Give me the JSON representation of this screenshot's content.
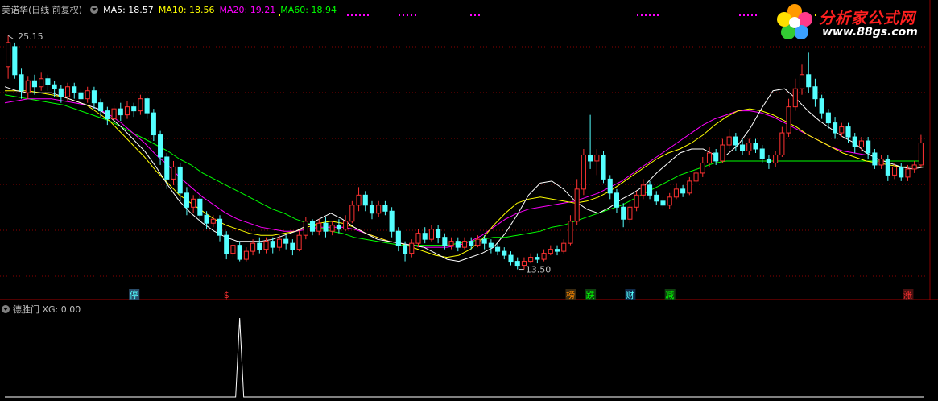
{
  "header": {
    "stock": "美诺华(日线 前复权)",
    "ma5": "MA5: 18.57",
    "ma10": "MA10: 18.56",
    "ma20": "MA20: 19.21",
    "ma60": "MA60: 18.94"
  },
  "indicator": {
    "name": "德胜门",
    "value": "XG: 0.00"
  },
  "logo": {
    "title": "分析家公式网",
    "url": "www.88gs.com"
  },
  "colors": {
    "up": "#ff3232",
    "down": "#54ffff",
    "ma5": "#ffffff",
    "ma10": "#ffff00",
    "ma20": "#ff00ff",
    "ma60": "#00ff00",
    "grid": "#8b0000"
  },
  "chart_data": {
    "type": "candlestick",
    "price_max_label": "25.15",
    "price_min_label": "13.50",
    "ylim": [
      12.8,
      26.2
    ],
    "candles": [
      [
        23.6,
        24.8,
        23.0,
        25.15
      ],
      [
        24.6,
        23.2,
        23.0,
        24.8
      ],
      [
        23.2,
        22.4,
        22.0,
        23.5
      ],
      [
        22.3,
        22.9,
        22.0,
        23.1
      ],
      [
        22.9,
        22.6,
        22.2,
        23.2
      ],
      [
        22.6,
        23.0,
        22.4,
        23.3
      ],
      [
        23.0,
        22.7,
        22.4,
        23.2
      ],
      [
        22.7,
        22.5,
        22.1,
        22.9
      ],
      [
        22.5,
        22.1,
        21.8,
        22.7
      ],
      [
        22.1,
        22.6,
        21.9,
        22.8
      ],
      [
        22.6,
        22.3,
        22.0,
        22.8
      ],
      [
        22.3,
        22.0,
        21.7,
        22.5
      ],
      [
        22.0,
        22.4,
        21.8,
        22.6
      ],
      [
        22.4,
        21.8,
        21.5,
        22.6
      ],
      [
        21.8,
        21.4,
        21.1,
        22.0
      ],
      [
        21.4,
        21.0,
        20.7,
        21.6
      ],
      [
        21.0,
        21.5,
        20.8,
        21.7
      ],
      [
        21.5,
        21.2,
        20.9,
        21.8
      ],
      [
        21.2,
        21.6,
        21.0,
        21.9
      ],
      [
        21.6,
        21.4,
        21.1,
        21.8
      ],
      [
        21.4,
        22.0,
        21.2,
        22.2
      ],
      [
        22.0,
        21.3,
        21.0,
        22.1
      ],
      [
        21.3,
        20.2,
        19.9,
        21.5
      ],
      [
        20.2,
        19.1,
        18.7,
        20.4
      ],
      [
        19.1,
        18.0,
        17.5,
        19.3
      ],
      [
        18.0,
        18.6,
        17.7,
        18.9
      ],
      [
        18.6,
        17.3,
        16.9,
        18.8
      ],
      [
        17.3,
        16.6,
        16.2,
        17.6
      ],
      [
        16.6,
        17.0,
        16.3,
        17.2
      ],
      [
        17.0,
        16.2,
        15.9,
        17.2
      ],
      [
        16.2,
        15.8,
        15.5,
        16.4
      ],
      [
        15.8,
        16.0,
        15.6,
        16.2
      ],
      [
        16.0,
        15.2,
        14.9,
        16.2
      ],
      [
        15.2,
        14.3,
        14.0,
        15.4
      ],
      [
        14.3,
        14.7,
        14.1,
        14.9
      ],
      [
        14.7,
        14.0,
        13.9,
        14.9
      ],
      [
        14.0,
        14.4,
        13.9,
        14.6
      ],
      [
        14.4,
        14.8,
        14.2,
        15.0
      ],
      [
        14.8,
        14.5,
        14.3,
        15.1
      ],
      [
        14.5,
        14.9,
        14.3,
        15.1
      ],
      [
        14.9,
        14.6,
        14.3,
        15.1
      ],
      [
        14.6,
        15.0,
        14.4,
        15.2
      ],
      [
        15.0,
        14.8,
        14.5,
        15.2
      ],
      [
        14.8,
        14.5,
        14.2,
        15.0
      ],
      [
        14.5,
        15.2,
        14.4,
        15.4
      ],
      [
        15.2,
        15.9,
        15.0,
        16.1
      ],
      [
        15.9,
        15.4,
        15.2,
        16.0
      ],
      [
        15.4,
        15.8,
        15.2,
        16.0
      ],
      [
        15.8,
        15.4,
        15.1,
        16.1
      ],
      [
        15.4,
        15.7,
        15.2,
        15.9
      ],
      [
        15.7,
        15.5,
        15.3,
        16.0
      ],
      [
        15.5,
        15.9,
        15.4,
        16.2
      ],
      [
        15.9,
        16.7,
        15.8,
        16.9
      ],
      [
        16.7,
        17.2,
        16.4,
        17.6
      ],
      [
        17.2,
        16.7,
        16.4,
        17.4
      ],
      [
        16.7,
        16.3,
        16.0,
        16.9
      ],
      [
        16.3,
        16.7,
        16.1,
        16.9
      ],
      [
        16.7,
        16.4,
        16.2,
        16.9
      ],
      [
        16.4,
        15.4,
        15.1,
        16.6
      ],
      [
        15.4,
        14.7,
        14.4,
        15.6
      ],
      [
        14.7,
        14.3,
        13.9,
        14.9
      ],
      [
        14.3,
        14.8,
        14.1,
        15.0
      ],
      [
        14.8,
        15.3,
        14.6,
        15.5
      ],
      [
        15.3,
        15.0,
        14.8,
        15.6
      ],
      [
        15.0,
        15.5,
        14.9,
        15.7
      ],
      [
        15.5,
        15.1,
        14.8,
        15.7
      ],
      [
        15.1,
        14.7,
        14.5,
        15.3
      ],
      [
        14.7,
        14.9,
        14.5,
        15.1
      ],
      [
        14.9,
        14.6,
        14.4,
        15.1
      ],
      [
        14.6,
        14.9,
        14.5,
        15.1
      ],
      [
        14.9,
        14.7,
        14.5,
        15.1
      ],
      [
        14.7,
        15.0,
        14.6,
        15.2
      ],
      [
        15.0,
        14.8,
        14.5,
        15.2
      ],
      [
        14.8,
        14.6,
        14.3,
        15.0
      ],
      [
        14.6,
        14.4,
        14.2,
        14.8
      ],
      [
        14.4,
        14.2,
        14.0,
        14.6
      ],
      [
        14.2,
        13.9,
        13.7,
        14.4
      ],
      [
        13.9,
        13.7,
        13.5,
        14.1
      ],
      [
        13.7,
        13.9,
        13.5,
        14.1
      ],
      [
        13.9,
        14.1,
        13.8,
        14.3
      ],
      [
        14.1,
        14.0,
        13.8,
        14.3
      ],
      [
        14.0,
        14.3,
        13.9,
        14.5
      ],
      [
        14.3,
        14.5,
        14.2,
        14.7
      ],
      [
        14.5,
        14.4,
        14.2,
        14.7
      ],
      [
        14.4,
        14.8,
        14.3,
        15.0
      ],
      [
        14.8,
        15.9,
        14.7,
        16.2
      ],
      [
        15.9,
        17.5,
        15.7,
        18.0
      ],
      [
        17.5,
        19.2,
        17.2,
        19.5
      ],
      [
        19.2,
        18.9,
        18.5,
        21.2
      ],
      [
        18.9,
        19.2,
        18.2,
        19.5
      ],
      [
        19.2,
        18.0,
        17.8,
        19.4
      ],
      [
        18.0,
        17.3,
        17.0,
        18.2
      ],
      [
        17.3,
        16.6,
        16.3,
        17.5
      ],
      [
        16.6,
        16.0,
        15.6,
        16.8
      ],
      [
        16.0,
        16.6,
        15.8,
        16.8
      ],
      [
        16.6,
        17.2,
        16.4,
        17.4
      ],
      [
        17.2,
        17.7,
        17.0,
        18.0
      ],
      [
        17.7,
        17.2,
        17.0,
        17.9
      ],
      [
        17.2,
        16.9,
        16.7,
        17.4
      ],
      [
        16.9,
        16.7,
        16.5,
        17.1
      ],
      [
        16.7,
        17.1,
        16.5,
        17.3
      ],
      [
        17.1,
        17.5,
        17.0,
        17.8
      ],
      [
        17.5,
        17.3,
        17.1,
        17.7
      ],
      [
        17.3,
        17.9,
        17.2,
        18.1
      ],
      [
        17.9,
        18.3,
        17.8,
        18.6
      ],
      [
        18.3,
        18.8,
        18.1,
        19.1
      ],
      [
        18.8,
        19.3,
        18.6,
        19.6
      ],
      [
        19.3,
        18.9,
        18.7,
        19.5
      ],
      [
        18.9,
        19.7,
        18.8,
        20.0
      ],
      [
        19.7,
        20.1,
        19.5,
        20.5
      ],
      [
        20.1,
        19.7,
        19.4,
        20.3
      ],
      [
        19.7,
        19.4,
        19.2,
        20.0
      ],
      [
        19.4,
        19.8,
        19.2,
        20.0
      ],
      [
        19.8,
        19.5,
        19.3,
        20.0
      ],
      [
        19.5,
        19.0,
        18.8,
        19.7
      ],
      [
        19.0,
        18.8,
        18.5,
        19.2
      ],
      [
        18.8,
        19.2,
        18.6,
        19.4
      ],
      [
        19.2,
        20.3,
        19.1,
        20.6
      ],
      [
        20.3,
        21.6,
        20.1,
        22.0
      ],
      [
        21.6,
        22.5,
        21.4,
        23.0
      ],
      [
        22.5,
        23.2,
        22.2,
        23.7
      ],
      [
        23.2,
        22.6,
        22.3,
        24.3
      ],
      [
        22.6,
        22.0,
        21.6,
        23.0
      ],
      [
        22.0,
        21.3,
        21.0,
        22.2
      ],
      [
        21.3,
        20.8,
        20.5,
        21.5
      ],
      [
        20.8,
        20.3,
        20.0,
        21.1
      ],
      [
        20.3,
        20.6,
        20.1,
        20.8
      ],
      [
        20.6,
        20.1,
        19.8,
        20.8
      ],
      [
        20.1,
        19.6,
        19.3,
        20.3
      ],
      [
        19.6,
        19.9,
        19.4,
        20.1
      ],
      [
        19.9,
        19.3,
        19.0,
        20.1
      ],
      [
        19.3,
        18.7,
        18.5,
        19.5
      ],
      [
        18.7,
        19.0,
        18.5,
        19.2
      ],
      [
        19.0,
        18.2,
        17.9,
        19.2
      ],
      [
        18.2,
        18.6,
        18.0,
        18.8
      ],
      [
        18.6,
        18.1,
        17.9,
        18.8
      ],
      [
        18.1,
        18.5,
        17.9,
        18.7
      ],
      [
        18.5,
        18.7,
        18.3,
        18.9
      ],
      [
        18.7,
        19.8,
        18.6,
        20.2
      ]
    ],
    "ma5": [
      22.6,
      22.4,
      22.3,
      22.3,
      22.3,
      22.1,
      21.9,
      21.7,
      21.5,
      21.1,
      20.6,
      20.0,
      19.4,
      18.6,
      17.7,
      16.9,
      16.3,
      15.8,
      15.4,
      15.1,
      14.9,
      14.9,
      14.9,
      15.0,
      15.2,
      15.4,
      15.7,
      16.0,
      16.3,
      16.0,
      15.6,
      15.3,
      15.0,
      14.9,
      14.8,
      14.7,
      14.6,
      14.3,
      14.0,
      13.9,
      14.1,
      14.3,
      14.6,
      15.3,
      16.2,
      17.2,
      17.8,
      17.9,
      17.5,
      16.9,
      16.5,
      16.3,
      16.6,
      17.0,
      17.3,
      17.7,
      18.3,
      18.8,
      19.3,
      19.5,
      19.5,
      19.2,
      19.2,
      19.7,
      20.5,
      21.5,
      22.4,
      22.5,
      22.0,
      21.4,
      20.9,
      20.5,
      20.1,
      19.8,
      19.3,
      19.0,
      18.8,
      18.6,
      18.5,
      18.6
    ],
    "ma10": [
      22.4,
      22.4,
      22.4,
      22.3,
      22.2,
      22.1,
      21.9,
      21.7,
      21.3,
      20.9,
      20.3,
      19.7,
      19.1,
      18.4,
      17.8,
      17.2,
      16.8,
      16.4,
      16.0,
      15.7,
      15.5,
      15.3,
      15.2,
      15.2,
      15.3,
      15.4,
      15.6,
      15.8,
      15.9,
      15.8,
      15.6,
      15.3,
      15.1,
      14.9,
      14.8,
      14.6,
      14.4,
      14.2,
      14.1,
      14.2,
      14.5,
      15.0,
      15.7,
      16.3,
      16.8,
      17.0,
      17.1,
      17.0,
      16.9,
      16.8,
      16.9,
      17.1,
      17.4,
      17.8,
      18.2,
      18.6,
      19.0,
      19.3,
      19.5,
      19.8,
      20.2,
      20.7,
      21.1,
      21.4,
      21.5,
      21.4,
      21.2,
      20.9,
      20.6,
      20.2,
      19.9,
      19.6,
      19.3,
      19.1,
      18.9,
      18.8,
      18.7,
      18.6,
      18.6,
      18.6
    ],
    "ma20": [
      21.8,
      21.9,
      22.0,
      22.0,
      22.0,
      21.9,
      21.8,
      21.7,
      21.5,
      21.2,
      20.8,
      20.3,
      19.8,
      19.2,
      18.7,
      18.1,
      17.6,
      17.1,
      16.7,
      16.3,
      16.0,
      15.8,
      15.6,
      15.5,
      15.4,
      15.4,
      15.5,
      15.6,
      15.6,
      15.6,
      15.5,
      15.3,
      15.1,
      14.9,
      14.8,
      14.7,
      14.6,
      14.6,
      14.6,
      14.7,
      14.9,
      15.2,
      15.6,
      16.0,
      16.3,
      16.5,
      16.6,
      16.7,
      16.8,
      16.9,
      17.1,
      17.3,
      17.6,
      17.9,
      18.3,
      18.7,
      19.1,
      19.5,
      19.9,
      20.3,
      20.7,
      21.0,
      21.2,
      21.4,
      21.4,
      21.3,
      21.1,
      20.8,
      20.5,
      20.2,
      19.9,
      19.6,
      19.4,
      19.3,
      19.2,
      19.2,
      19.2,
      19.2,
      19.2,
      19.2
    ],
    "ma60": [
      22.2,
      22.1,
      22.0,
      21.9,
      21.8,
      21.7,
      21.5,
      21.3,
      21.1,
      20.9,
      20.6,
      20.3,
      20.0,
      19.7,
      19.4,
      19.0,
      18.7,
      18.3,
      18.0,
      17.7,
      17.4,
      17.1,
      16.8,
      16.5,
      16.3,
      16.0,
      15.8,
      15.6,
      15.4,
      15.3,
      15.1,
      15.0,
      14.9,
      14.8,
      14.7,
      14.7,
      14.7,
      14.7,
      14.7,
      14.8,
      14.9,
      15.0,
      15.1,
      15.1,
      15.2,
      15.3,
      15.4,
      15.6,
      15.7,
      15.9,
      16.1,
      16.3,
      16.5,
      16.7,
      17.0,
      17.3,
      17.6,
      17.9,
      18.2,
      18.4,
      18.6,
      18.8,
      18.9,
      18.9,
      18.9,
      18.9,
      18.9,
      18.9,
      18.9,
      18.9,
      18.9,
      18.9,
      18.9,
      18.9,
      18.9,
      18.9,
      18.9,
      18.9,
      18.9,
      18.9
    ],
    "markers": [
      {
        "label": "停",
        "index": 19,
        "color": "#54ffff",
        "bg": "#2a4c6a"
      },
      {
        "label": "$",
        "index": 33,
        "color": "#ff3232",
        "bg": "none"
      },
      {
        "label": "榜",
        "index": 85,
        "color": "#ff8800",
        "bg": "#3a2a10"
      },
      {
        "label": "跌",
        "index": 88,
        "color": "#00ff00",
        "bg": "#104010"
      },
      {
        "label": "财",
        "index": 94,
        "color": "#54ffff",
        "bg": "#102a4a"
      },
      {
        "label": "减",
        "index": 100,
        "color": "#00ff00",
        "bg": "#104010"
      },
      {
        "label": "涨",
        "index": 136,
        "color": "#ff3232",
        "bg": "#4a1010"
      }
    ],
    "indicator": {
      "name": "XG",
      "signal_index": 35,
      "signal_value": 1
    }
  }
}
